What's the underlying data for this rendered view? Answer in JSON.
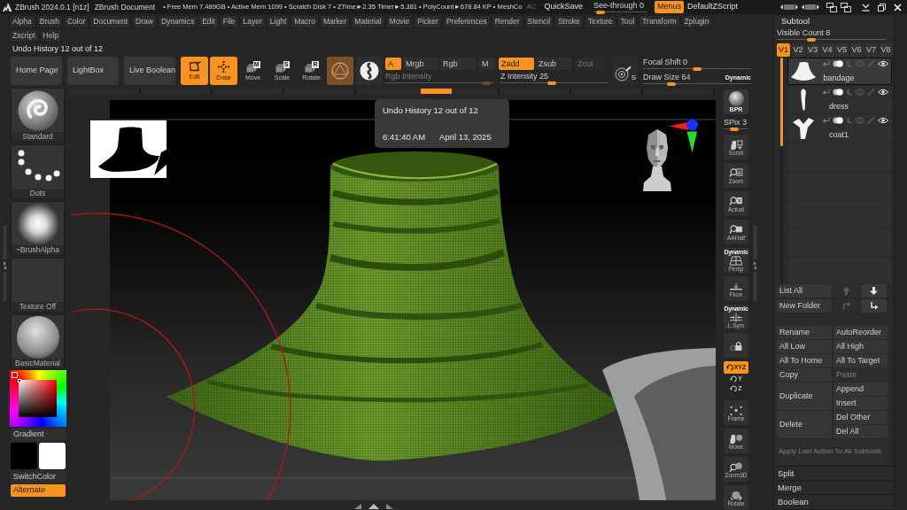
{
  "title_bar": {
    "app_title": "ZBrush 2024.0.1 [n1z]",
    "document": "ZBrush Document",
    "stats": "• Free Mem 7.489GB • Active Mem 1099 • Scratch Disk 7 • ZTime►2.35 Timer►5.381 • PolyCount►678.84 KP • MeshCo",
    "ac": "AC",
    "quicksave": "QuickSave",
    "see_through": {
      "label": "See-through 0",
      "level": 0.05
    },
    "menus": {
      "label": "Menus",
      "on": true
    },
    "script": "DefaultZScript"
  },
  "menu_rows": [
    [
      "Alpha",
      "Brush",
      "Color",
      "Document",
      "Draw",
      "Dynamics",
      "Edit",
      "File",
      "Layer",
      "Light",
      "Macro",
      "Marker",
      "Material",
      "Movie",
      "Picker",
      "Preferences",
      "Render",
      "Stencil",
      "Stroke",
      "Texture",
      "Tool",
      "Transform",
      "Zplugin"
    ],
    [
      "Zscript",
      "Help"
    ]
  ],
  "undo_label": "Undo History 12 out of 12",
  "toolbar": {
    "nav": [
      "Home Page",
      "LightBox",
      "Live Boolean"
    ],
    "modes": [
      {
        "label": "Edit",
        "kind": "edit",
        "selected": true
      },
      {
        "label": "Draw",
        "kind": "draw",
        "selected": true
      },
      {
        "label": "Move",
        "kind": "move",
        "letter": "M",
        "selected": false
      },
      {
        "label": "Scale",
        "kind": "scale",
        "letter": "S",
        "selected": false
      },
      {
        "label": "Rotate",
        "kind": "rotate",
        "letter": "R",
        "selected": false
      }
    ],
    "color_modes": [
      {
        "label": "A",
        "selected": true
      },
      {
        "label": "Mrgb",
        "selected": false
      },
      {
        "label": "Rgb",
        "selected": false
      },
      {
        "label": "M",
        "selected": false
      }
    ],
    "z_modes": [
      {
        "label": "Zadd",
        "selected": true,
        "disabled": false
      },
      {
        "label": "Zsub",
        "selected": false,
        "disabled": false
      },
      {
        "label": "Zcut",
        "selected": false,
        "disabled": true
      }
    ],
    "intensity_sliders": [
      {
        "label": "Rgb Intensity",
        "disabled": true,
        "level": 0.97
      },
      {
        "label": "Z Intensity 25",
        "disabled": false,
        "level": 0.47
      }
    ],
    "stroke_letter": "S",
    "brush_sliders": [
      {
        "label": "Focal Shift 0",
        "level": 0.5
      },
      {
        "label": "Draw Size 64",
        "level": 0.24
      }
    ],
    "dynamic": "Dynamic"
  },
  "undo_tooltip": {
    "title": "Undo History 12 out of 12",
    "time": "6:41:40 AM",
    "date": "April 13, 2025"
  },
  "left_shelf": {
    "tiles": [
      {
        "label": "Standard",
        "kind": "brush"
      },
      {
        "label": "Dots",
        "kind": "stroke"
      },
      {
        "label": "~BrushAlpha",
        "kind": "alpha"
      },
      {
        "label": "Texture Off",
        "kind": "texture"
      },
      {
        "label": "BasicMaterial",
        "kind": "material"
      }
    ],
    "gradient": "Gradient",
    "swatches": [
      {
        "color": "#000000"
      },
      {
        "color": "#ffffff"
      }
    ],
    "switch_color": "SwitchColor",
    "alternate": {
      "label": "Alternate",
      "on": true
    }
  },
  "right_shelf": {
    "tools": [
      {
        "kind": "bpr",
        "label": "BPR"
      },
      {
        "kind": "spix",
        "label": "SPix 3",
        "level": 0.4
      },
      {
        "kind": "scroll",
        "label": "Scroll"
      },
      {
        "kind": "zoom",
        "label": "Zoom"
      },
      {
        "kind": "actual",
        "label": "Actual"
      },
      {
        "kind": "aahalf",
        "label": "AAHalf"
      },
      {
        "kind": "persp",
        "label": "Persp",
        "caption": "Dynamic"
      },
      {
        "kind": "floor",
        "label": "Floor"
      },
      {
        "kind": "lsym",
        "label": "L.Sym",
        "caption": "Dynamic"
      },
      {
        "kind": "lock"
      }
    ],
    "rotation_axes": [
      {
        "label": "XYZ",
        "selected": true
      },
      {
        "label": "Y",
        "selected": false
      },
      {
        "label": "Z",
        "selected": false
      }
    ],
    "navigation": [
      {
        "kind": "frame",
        "label": "Frame"
      },
      {
        "kind": "move",
        "label": "Move"
      },
      {
        "kind": "zoom3d",
        "label": "Zoom3D"
      },
      {
        "kind": "rotate",
        "label": "Rotate"
      }
    ]
  },
  "subtool_panel": {
    "title": "Subtool",
    "visible_count": {
      "label": "Visible Count 8",
      "level": 0.3
    },
    "versions": [
      {
        "label": "V1",
        "selected": true
      },
      {
        "label": "V2",
        "selected": false
      },
      {
        "label": "V3",
        "selected": false
      },
      {
        "label": "V4",
        "selected": false
      },
      {
        "label": "V5",
        "selected": false
      },
      {
        "label": "V6",
        "selected": false
      },
      {
        "label": "V7",
        "selected": false
      },
      {
        "label": "V8",
        "selected": false
      }
    ],
    "items": [
      {
        "name": "bandage",
        "kind": "bell",
        "selected": true
      },
      {
        "name": "dress",
        "kind": "slim",
        "selected": false
      },
      {
        "name": "coat1",
        "kind": "forked",
        "selected": false
      },
      {
        "kind": "empty",
        "selected": false
      },
      {
        "kind": "empty",
        "selected": false
      },
      {
        "kind": "empty",
        "selected": false
      },
      {
        "kind": "empty",
        "selected": false
      },
      {
        "kind": "empty",
        "selected": false
      }
    ],
    "list_all": "List All",
    "new_folder": "New Folder",
    "arrows": [
      {
        "kind": "up",
        "disabled": true
      },
      {
        "kind": "down",
        "disabled": false
      },
      {
        "kind": "redirect",
        "disabled": true
      },
      {
        "kind": "bent",
        "disabled": false
      }
    ],
    "actions": [
      {
        "label": "Rename",
        "disabled": false
      },
      {
        "label": "AutoReorder",
        "disabled": false
      },
      {
        "label": "All Low",
        "disabled": false
      },
      {
        "label": "All High",
        "disabled": false
      },
      {
        "label": "All To Home",
        "disabled": false
      },
      {
        "label": "All To Target",
        "disabled": false
      },
      {
        "label": "Copy",
        "disabled": false
      },
      {
        "label": "Paste",
        "disabled": true
      }
    ],
    "groups": [
      {
        "label": "Duplicate",
        "options": [
          "Append",
          "Insert"
        ]
      },
      {
        "label": "Delete",
        "options": [
          "Del Other",
          "Del All"
        ]
      }
    ],
    "apply_all": {
      "label": "Apply Last Action To All Subtools",
      "disabled": true
    },
    "sections": [
      "Split",
      "Merge",
      "Boolean"
    ]
  }
}
